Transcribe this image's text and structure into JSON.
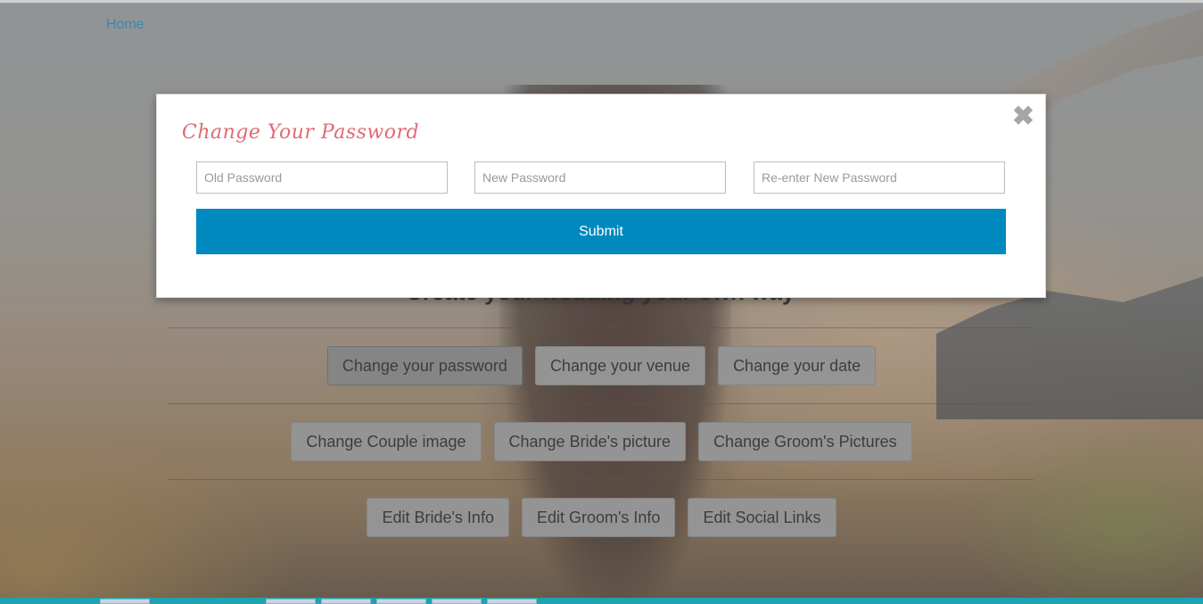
{
  "nav": {
    "home_label": "Home"
  },
  "background": {
    "heading": "Create your wedding your own way",
    "rows": [
      [
        {
          "label": "Change your password",
          "active": true
        },
        {
          "label": "Change your venue"
        },
        {
          "label": "Change your date"
        }
      ],
      [
        {
          "label": "Change Couple image"
        },
        {
          "label": "Change Bride's picture"
        },
        {
          "label": "Change Groom's Pictures"
        }
      ],
      [
        {
          "label": "Edit Bride's Info"
        },
        {
          "label": "Edit Groom's Info"
        },
        {
          "label": "Edit Social Links"
        }
      ]
    ]
  },
  "modal": {
    "title": "Change Your Password",
    "close_symbol": "✖",
    "old_password_placeholder": "Old Password",
    "new_password_placeholder": "New Password",
    "reenter_password_placeholder": "Re-enter New Password",
    "submit_label": "Submit"
  },
  "colors": {
    "accent": "#0089bf",
    "title": "#e06a74",
    "link": "#1b8fd1"
  }
}
